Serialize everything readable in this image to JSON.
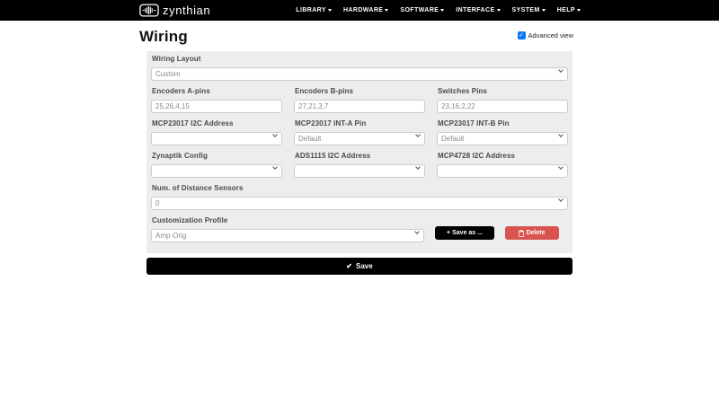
{
  "navbar": {
    "brand": "zynthian",
    "items": [
      {
        "label": "LIBRARY"
      },
      {
        "label": "HARDWARE"
      },
      {
        "label": "SOFTWARE"
      },
      {
        "label": "INTERFACE"
      },
      {
        "label": "SYSTEM"
      },
      {
        "label": "HELP"
      }
    ]
  },
  "page": {
    "title": "Wiring",
    "advanced_view": {
      "label": "Advanced view",
      "checked": true,
      "checkmark_icon": "✓"
    }
  },
  "form": {
    "wiring_layout": {
      "label": "Wiring Layout",
      "value": "Custom"
    },
    "encoders_a": {
      "label": "Encoders A-pins",
      "value": "25,26,4,15"
    },
    "encoders_b": {
      "label": "Encoders B-pins",
      "value": "27,21,3,7"
    },
    "switches_pins": {
      "label": "Switches Pins",
      "value": "23,16,2,22"
    },
    "mcp23017_i2c": {
      "label": "MCP23017 I2C Address",
      "value": ""
    },
    "mcp23017_inta": {
      "label": "MCP23017 INT-A Pin",
      "value": "Default"
    },
    "mcp23017_intb": {
      "label": "MCP23017 INT-B Pin",
      "value": "Default"
    },
    "zynaptik_config": {
      "label": "Zynaptik Config",
      "value": ""
    },
    "ads1115_i2c": {
      "label": "ADS1115 I2C Address",
      "value": ""
    },
    "mcp4728_i2c": {
      "label": "MCP4728 I2C Address",
      "value": ""
    },
    "distance_sensors": {
      "label": "Num. of Distance Sensors",
      "value": "0"
    },
    "customization_profile": {
      "label": "Customization Profile",
      "value": "Amp-Orig"
    }
  },
  "buttons": {
    "save_as": {
      "label": "Save as ...",
      "plus_icon": "+"
    },
    "delete": {
      "label": "Delete"
    },
    "save": {
      "label": "Save",
      "check_icon": "✔"
    }
  },
  "colors": {
    "navbar_bg": "#000000",
    "panel_bg": "#ededed",
    "delete_red": "#d9534f",
    "checkbox_blue": "#0b76ef"
  }
}
